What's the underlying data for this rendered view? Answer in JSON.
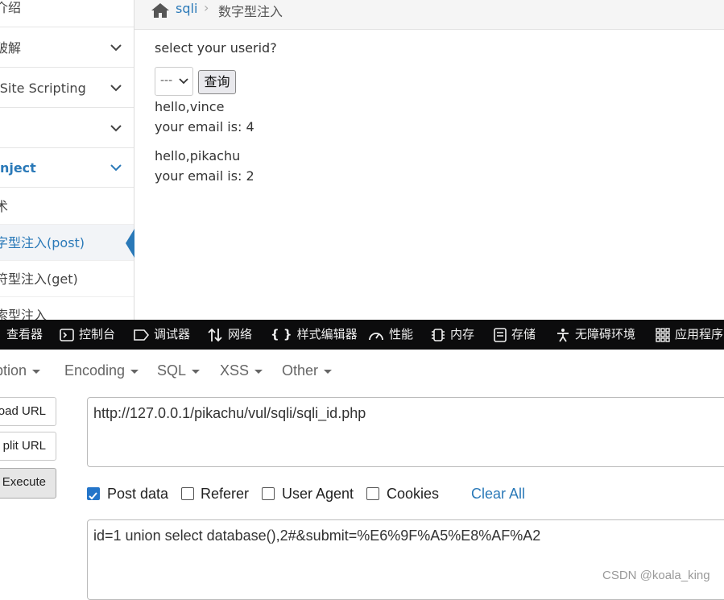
{
  "sidebar": {
    "items": [
      {
        "label": "介绍"
      },
      {
        "label": "破解"
      },
      {
        "label": "-Site Scripting"
      },
      {
        "label": ""
      },
      {
        "label": "Inject"
      }
    ],
    "subitems": [
      {
        "label": "术"
      },
      {
        "label": "字型注入(post)"
      },
      {
        "label": "符型注入(get)"
      },
      {
        "label": "索型注入"
      }
    ]
  },
  "breadcrumb": {
    "link": "sqli",
    "separator": "›",
    "current": "数字型注入"
  },
  "main": {
    "prompt": "select your userid?",
    "select_value": "---",
    "query_button": "查询",
    "results": [
      {
        "hello": "hello,vince",
        "email": "your email is: 4"
      },
      {
        "hello": "hello,pikachu",
        "email": "your email is: 2"
      }
    ]
  },
  "devtools": {
    "tabs": [
      {
        "label": "查看器",
        "icon": "inspector-icon"
      },
      {
        "label": "控制台",
        "icon": "console-icon"
      },
      {
        "label": "调试器",
        "icon": "debugger-icon"
      },
      {
        "label": "网络",
        "icon": "network-icon"
      },
      {
        "label": "样式编辑器",
        "icon": "style-editor-icon"
      },
      {
        "label": "性能",
        "icon": "performance-icon"
      },
      {
        "label": "内存",
        "icon": "memory-icon"
      },
      {
        "label": "存储",
        "icon": "storage-icon"
      },
      {
        "label": "无障碍环境",
        "icon": "accessibility-icon"
      },
      {
        "label": "应用程序",
        "icon": "application-icon"
      }
    ]
  },
  "hackbar": {
    "menus": [
      "ption",
      "Encoding",
      "SQL",
      "XSS",
      "Other"
    ],
    "load_url": "oad URL",
    "split_url": "plit URL",
    "execute": "Execute",
    "url_value": "http://127.0.0.1/pikachu/vul/sqli/sqli_id.php",
    "options": [
      {
        "label": "Post data",
        "checked": true
      },
      {
        "label": "Referer",
        "checked": false
      },
      {
        "label": "User Agent",
        "checked": false
      },
      {
        "label": "Cookies",
        "checked": false
      }
    ],
    "clear_all": "Clear All",
    "post_value": "id=1 union select database(),2#&submit=%E6%9F%A5%E8%AF%A2"
  },
  "watermark": "CSDN @koala_king",
  "colors": {
    "accent": "#2a79b8",
    "devtools_bg": "#0c0c0d",
    "checkbox": "#2475c9"
  }
}
